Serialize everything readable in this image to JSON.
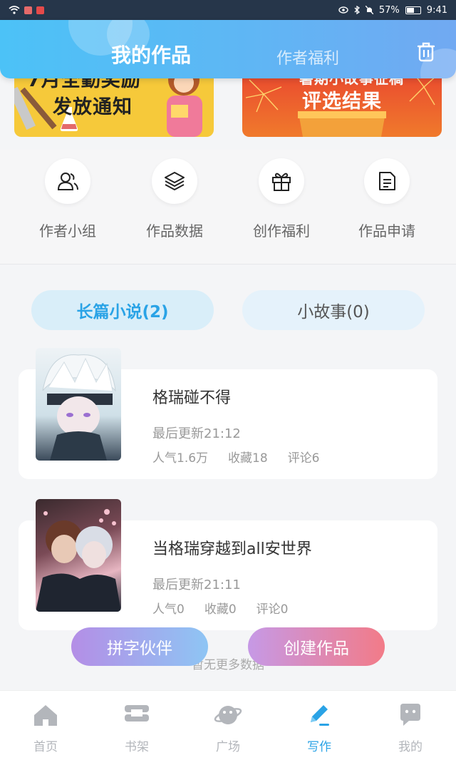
{
  "status_bar": {
    "battery": "57%",
    "time": "9:41"
  },
  "header": {
    "title": "我的作品",
    "tab_welfare": "作者福利"
  },
  "banners": [
    {
      "line1": "7月全勤奖励",
      "line2": "发放通知"
    },
    {
      "line1": "暑期小故事征稿",
      "line2": "评选结果"
    }
  ],
  "actions": [
    {
      "label": "作者小组",
      "icon": "group-icon"
    },
    {
      "label": "作品数据",
      "icon": "layers-icon"
    },
    {
      "label": "创作福利",
      "icon": "gift-icon"
    },
    {
      "label": "作品申请",
      "icon": "document-icon"
    }
  ],
  "tabs": {
    "long_novel": "长篇小说(2)",
    "short_story": "小故事(0)"
  },
  "works": [
    {
      "title": "格瑞碰不得",
      "updated": "最后更新21:12",
      "popularity": "人气1.6万",
      "favorites": "收藏18",
      "comments": "评论6"
    },
    {
      "title": "当格瑞穿越到all安世界",
      "updated": "最后更新21:11",
      "popularity": "人气0",
      "favorites": "收藏0",
      "comments": "评论0"
    }
  ],
  "buttons": {
    "partner": "拼字伙伴",
    "create": "创建作品"
  },
  "no_more": "暂无更多数据",
  "bottom_nav": [
    {
      "label": "首页",
      "icon": "home-icon"
    },
    {
      "label": "书架",
      "icon": "bookshelf-icon"
    },
    {
      "label": "广场",
      "icon": "planet-icon"
    },
    {
      "label": "写作",
      "icon": "pen-icon",
      "active": true
    },
    {
      "label": "我的",
      "icon": "chat-bubble-icon"
    }
  ],
  "colors": {
    "accent": "#2aa3e6",
    "header_start": "#4cc2f7",
    "header_end": "#71a9f2"
  }
}
